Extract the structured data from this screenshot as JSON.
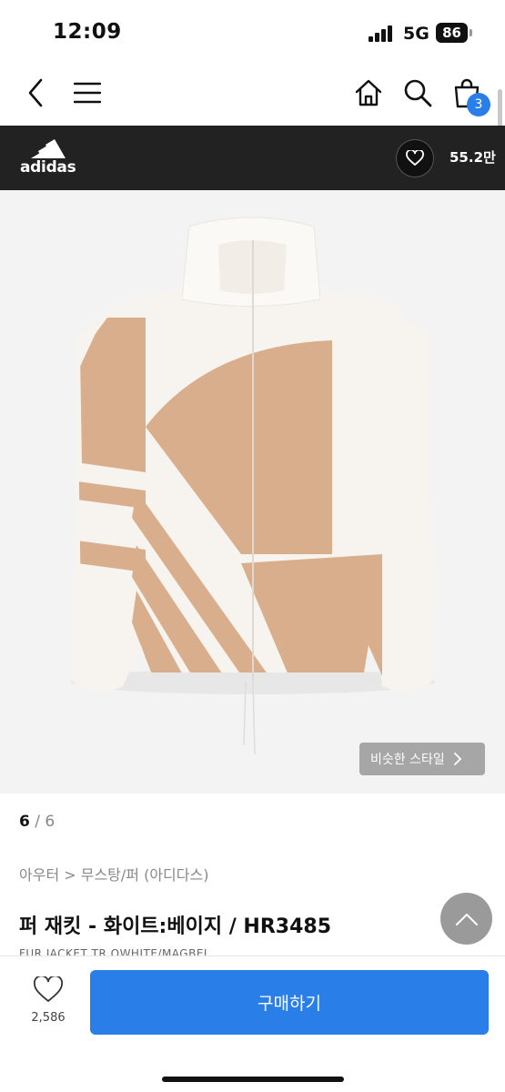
{
  "status_bar": {
    "time": "12:09",
    "network": "5G",
    "battery": "86"
  },
  "nav": {
    "cart_count": "3",
    "icons": [
      "back-icon",
      "menu-icon",
      "home-icon",
      "search-icon",
      "cart-icon"
    ]
  },
  "brand": {
    "name": "adidas",
    "like_count": "55.2만"
  },
  "image": {
    "similar_style_label": "비슷한 스타일"
  },
  "pager": {
    "current": "6",
    "separator": " / ",
    "total": "6"
  },
  "product": {
    "category": "아우터 > 무스탕/퍼 (아디다스)",
    "title": "퍼 재킷 - 화이트:베이지 / HR3485",
    "subtitle": "FUR JACKET TR OWHITE/MAGBEI"
  },
  "bottom": {
    "wish_count": "2,586",
    "buy_label": "구매하기"
  },
  "colors": {
    "accent": "#2a7ee8",
    "brand_bar": "#222222",
    "fur_beige": "#d9ae8c",
    "fur_white": "#f7f4ef"
  }
}
